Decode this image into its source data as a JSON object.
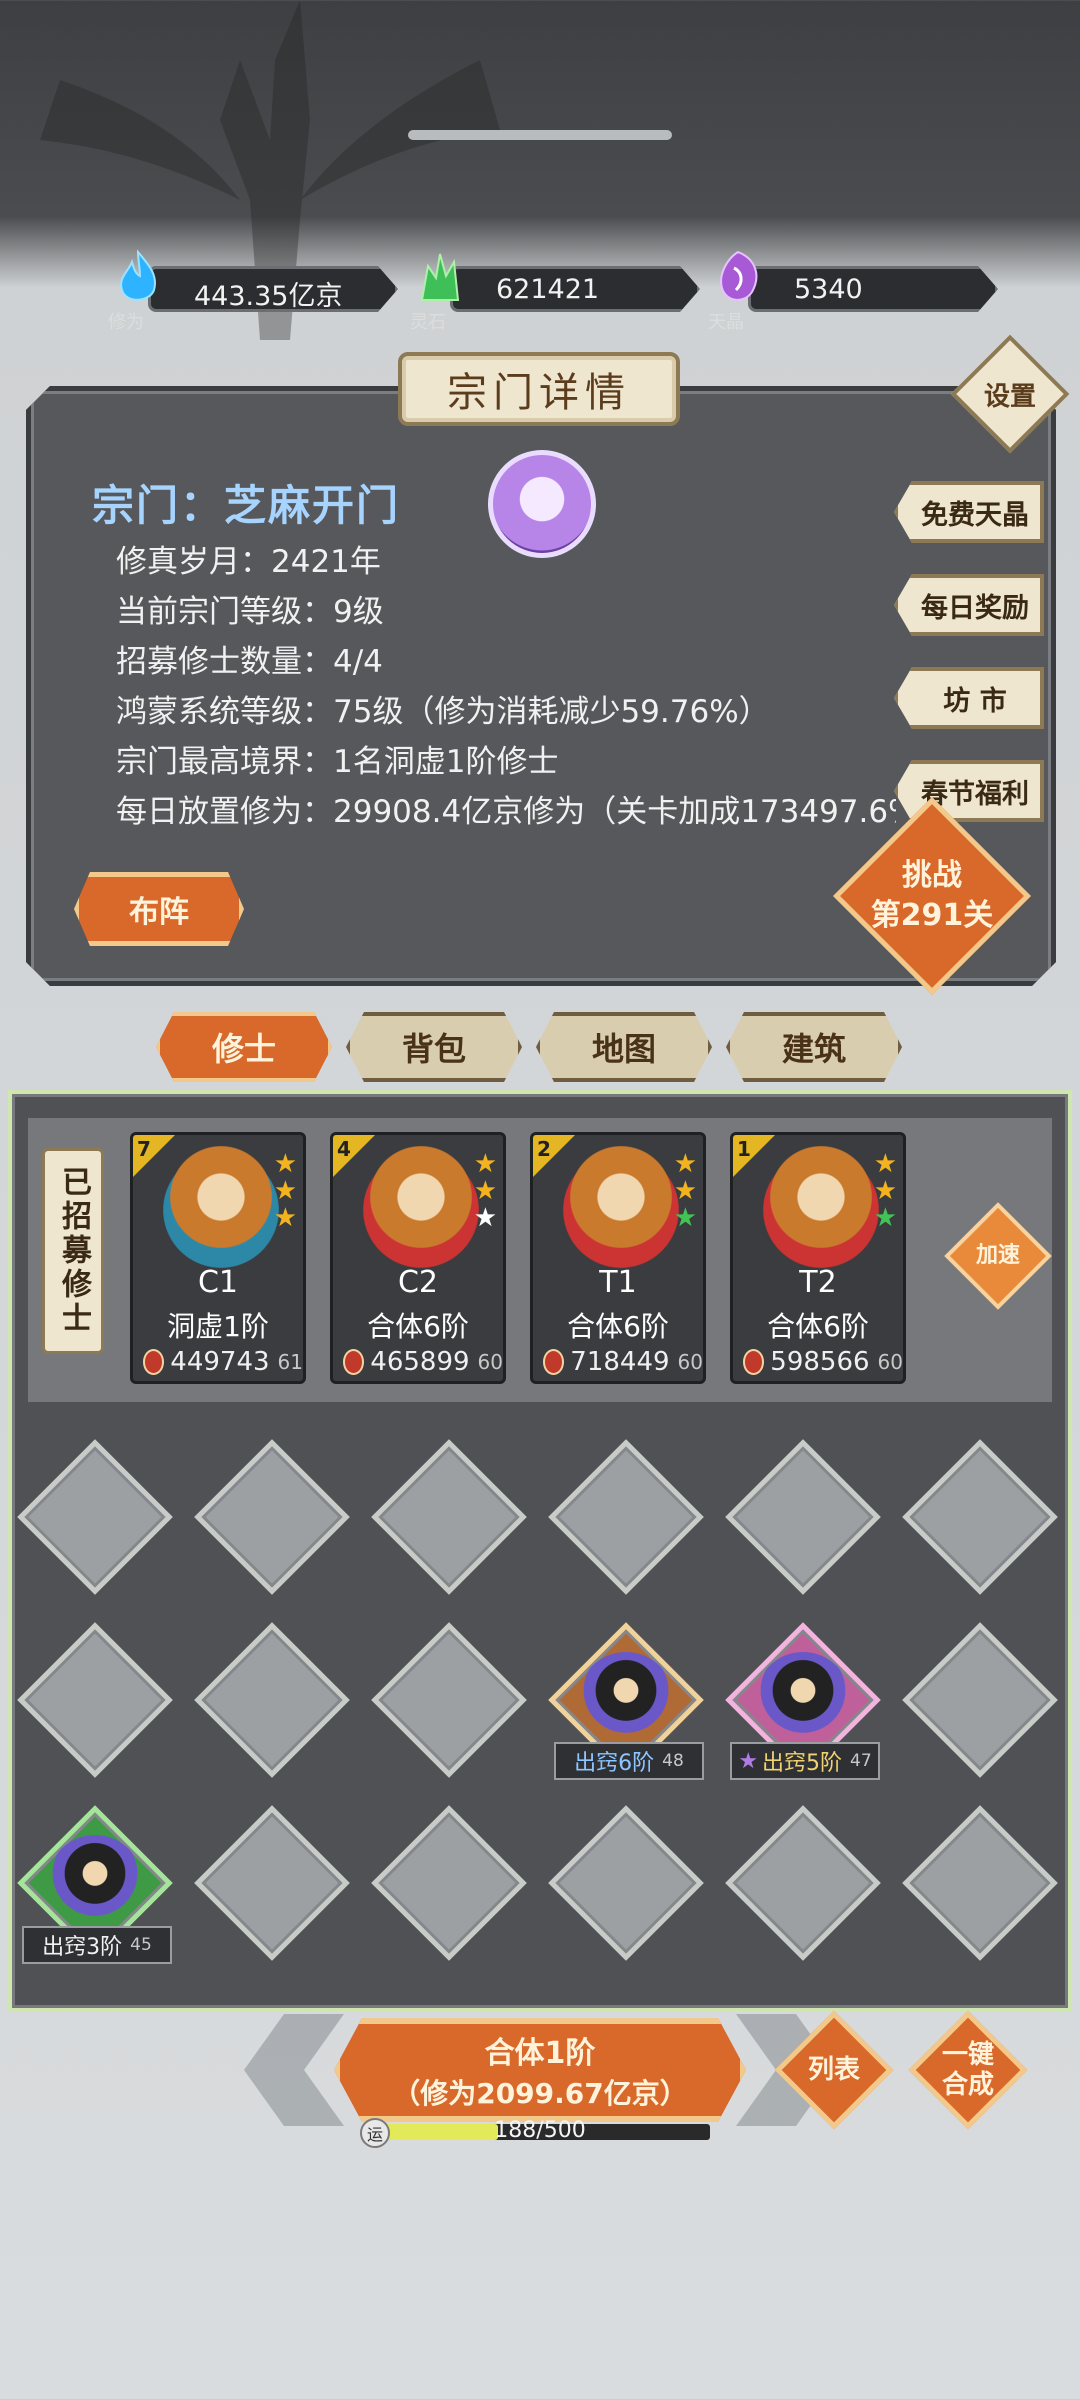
{
  "resources": [
    {
      "name": "修为",
      "value": "443.35亿京",
      "icon": "blue-flame-icon",
      "color": "#2db3ff"
    },
    {
      "name": "灵石",
      "value": "621421",
      "icon": "green-crystal-icon",
      "color": "#3fbf58"
    },
    {
      "name": "天晶",
      "value": "5340",
      "icon": "purple-crystal-icon",
      "color": "#a85ad6"
    }
  ],
  "panel": {
    "title": "宗门详情",
    "settings_label": "设置",
    "sect_name": "宗门：芝麻开门",
    "info": [
      "修真岁月：2421年",
      "当前宗门等级：9级",
      "招募修士数量：4/4",
      "鸿蒙系统等级：75级（修为消耗减少59.76%）",
      "宗门最高境界：1名洞虚1阶修士",
      "每日放置修为：29908.4亿京修为（关卡加成173497.6%）"
    ],
    "side_buttons": [
      "免费天晶",
      "每日奖励",
      "坊 市",
      "春节福利"
    ],
    "formation_label": "布阵",
    "challenge": {
      "line1": "挑战",
      "line2": "第291关"
    }
  },
  "tabs": [
    {
      "label": "修士",
      "active": true
    },
    {
      "label": "背包",
      "active": false
    },
    {
      "label": "地图",
      "active": false
    },
    {
      "label": "建筑",
      "active": false
    }
  ],
  "recruited_label": "已招募修士",
  "cultivators": [
    {
      "level": "7",
      "name": "C1",
      "realm": "洞虚1阶",
      "power": "449743",
      "sub": "61",
      "stars": [
        "#f2b31e",
        "#f2b31e",
        "#f2b31e"
      ],
      "portrait": "blue"
    },
    {
      "level": "4",
      "name": "C2",
      "realm": "合体6阶",
      "power": "465899",
      "sub": "60",
      "stars": [
        "#f2b31e",
        "#f2b31e",
        "#ffffff"
      ],
      "portrait": "red"
    },
    {
      "level": "2",
      "name": "T1",
      "realm": "合体6阶",
      "power": "718449",
      "sub": "60",
      "stars": [
        "#f2b31e",
        "#f2b31e",
        "#41c453"
      ],
      "portrait": "red"
    },
    {
      "level": "1",
      "name": "T2",
      "realm": "合体6阶",
      "power": "598566",
      "sub": "60",
      "stars": [
        "#f2b31e",
        "#f2b31e",
        "#41c453"
      ],
      "portrait": "red"
    }
  ],
  "speed_label": "加速",
  "slots": {
    "occupied": [
      {
        "tag": "出窍6阶",
        "sub": "48",
        "color": "blue"
      },
      {
        "tag": "出窍5阶",
        "sub": "47",
        "color": "gold"
      },
      {
        "tag": "出窍3阶",
        "sub": "45",
        "color": "white"
      }
    ]
  },
  "merge": {
    "line1": "合体1阶",
    "line2": "（修为2099.67亿京）"
  },
  "list_label": "列表",
  "auto_merge_label": "一键合成",
  "luck": {
    "icon_text": "运",
    "text": "188/500",
    "fraction": 0.376
  }
}
